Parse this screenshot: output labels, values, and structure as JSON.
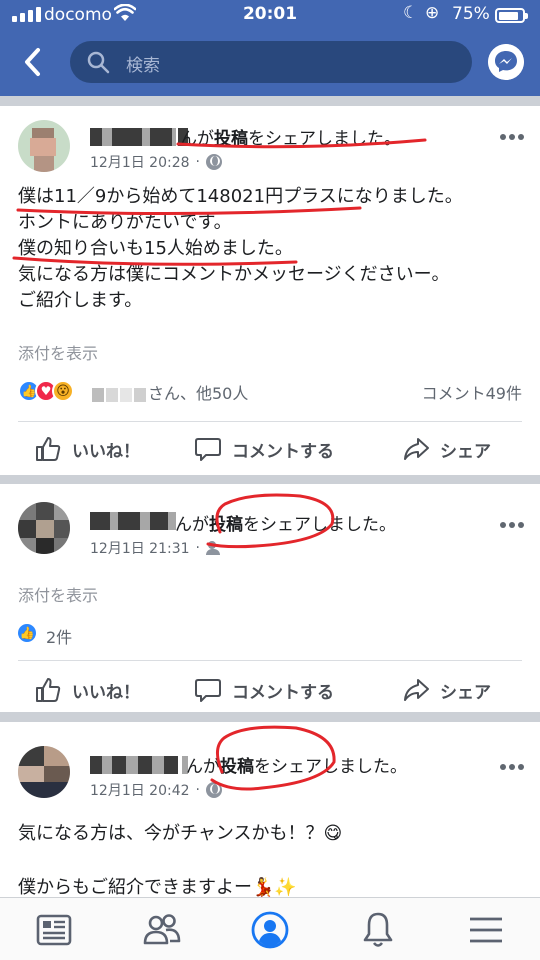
{
  "status_bar": {
    "carrier": "docomo",
    "time": "20:01",
    "battery": "75%"
  },
  "nav": {
    "search_placeholder": "検索"
  },
  "posts": [
    {
      "author_suffix": "んが",
      "shared_word": "投稿",
      "shared_tail": "をシェアしました。",
      "date": "12月1日 20:28",
      "privacy_icon": "globe-icon",
      "body": [
        "僕は11／9から始めて148021円プラスになりました。",
        "ホントにありがたいです。",
        "僕の知り合いも15人始めました。",
        "気になる方は僕にコメントかメッセージくださいー。",
        "ご紹介します。"
      ],
      "attachment_link": "添付を表示",
      "reactions_text": "さん、他50人",
      "comments": "コメント49件",
      "like": "いいね！",
      "comment": "コメントする",
      "share": "シェア"
    },
    {
      "author_suffix": "んが",
      "shared_word": "投稿",
      "shared_tail": "をシェアしました。",
      "date": "12月1日 21:31",
      "privacy_icon": "friends-icon",
      "attachment_link": "添付を表示",
      "reactions_text": "2件",
      "like": "いいね！",
      "comment": "コメントする",
      "share": "シェア"
    },
    {
      "author_suffix": "んが",
      "shared_word": "投稿",
      "shared_tail": "をシェアしました。",
      "date": "12月1日 20:42",
      "privacy_icon": "globe-icon",
      "body": [
        "気になる方は、今がチャンスかも！？😋",
        "",
        "僕からもご紹介できますよー💃✨"
      ]
    }
  ],
  "colors": {
    "header": "#4267b2",
    "search": "#29487d",
    "like_blue": "#2d88ff",
    "annotation_red": "#e3262b"
  },
  "tabs": [
    "news-feed-icon",
    "friends-icon",
    "profile-icon",
    "notifications-icon",
    "menu-icon"
  ]
}
